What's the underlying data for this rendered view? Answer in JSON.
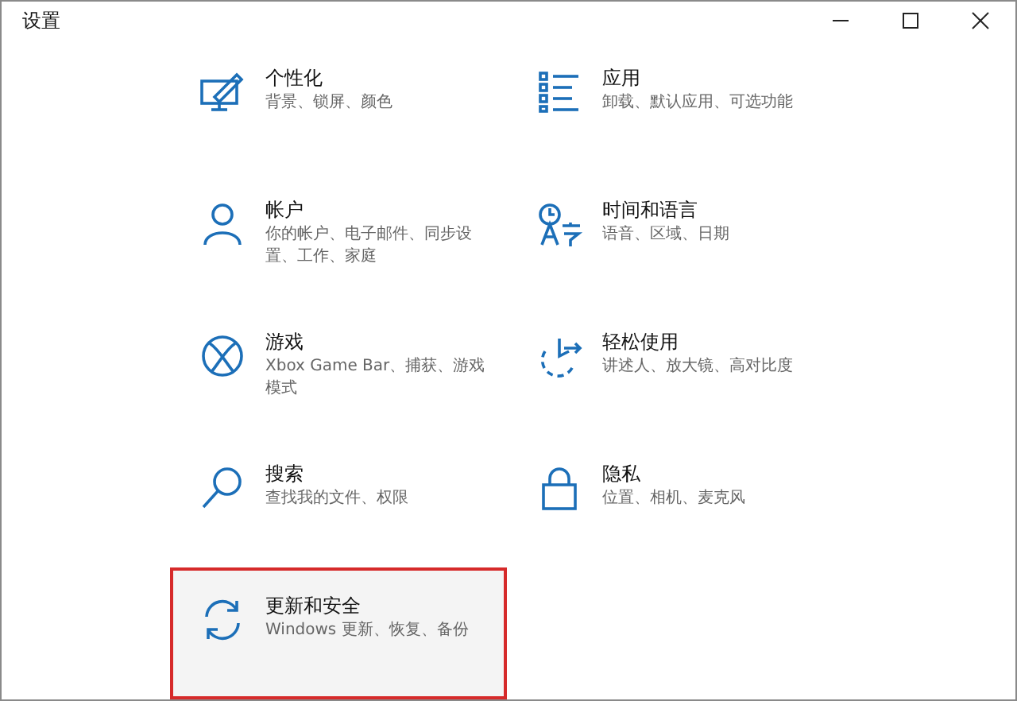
{
  "window": {
    "title": "设置",
    "controls": [
      {
        "kind": "minimize"
      },
      {
        "kind": "maximize"
      },
      {
        "kind": "close"
      }
    ]
  },
  "categories": [
    {
      "kind": "personalization",
      "title": "个性化",
      "description": "背景、锁屏、颜色",
      "highlighted": false
    },
    {
      "kind": "apps",
      "title": "应用",
      "description": "卸载、默认应用、可选功能",
      "highlighted": false
    },
    {
      "kind": "accounts",
      "title": "帐户",
      "description": "你的帐户、电子邮件、同步设置、工作、家庭",
      "highlighted": false
    },
    {
      "kind": "time-language",
      "title": "时间和语言",
      "description": "语音、区域、日期",
      "highlighted": false
    },
    {
      "kind": "gaming",
      "title": "游戏",
      "description": "Xbox Game Bar、捕获、游戏模式",
      "highlighted": false
    },
    {
      "kind": "ease",
      "title": "轻松使用",
      "description": "讲述人、放大镜、高对比度",
      "highlighted": false
    },
    {
      "kind": "search",
      "title": "搜索",
      "description": "查找我的文件、权限",
      "highlighted": false
    },
    {
      "kind": "privacy",
      "title": "隐私",
      "description": "位置、相机、麦克风",
      "highlighted": false
    },
    {
      "kind": "update",
      "title": "更新和安全",
      "description": "Windows 更新、恢复、备份",
      "highlighted": true
    }
  ]
}
